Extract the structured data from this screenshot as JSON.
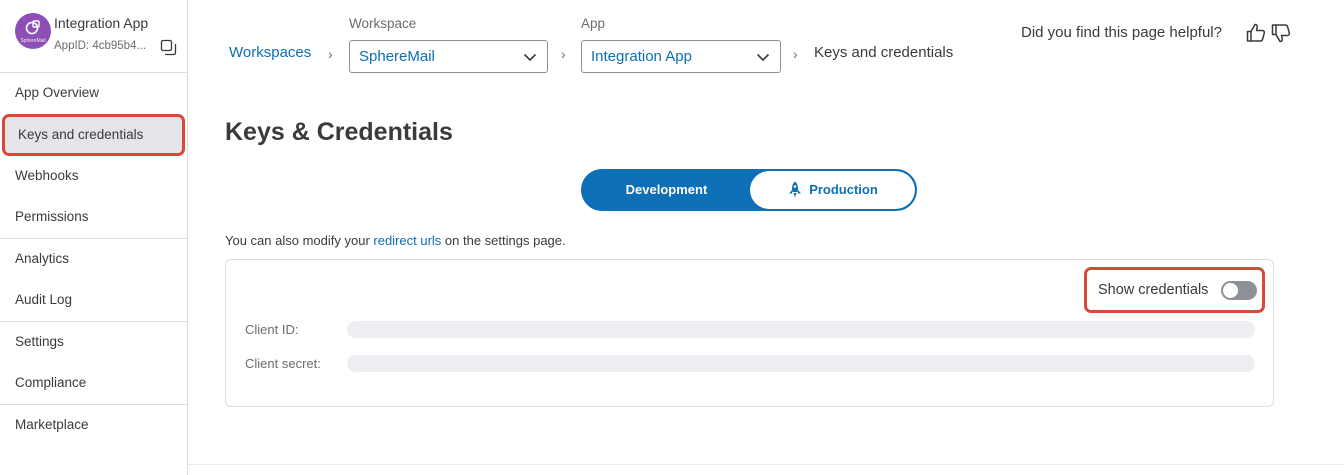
{
  "app": {
    "name": "Integration App",
    "app_id": "AppID: 4cb95b4...",
    "avatar_text": "SphereMail",
    "avatar_color": "#8d4fb5"
  },
  "sidebar": {
    "items": [
      {
        "label": "App Overview"
      },
      {
        "label": "Keys and credentials"
      },
      {
        "label": "Webhooks"
      },
      {
        "label": "Permissions"
      },
      {
        "label": "Analytics"
      },
      {
        "label": "Audit Log"
      },
      {
        "label": "Settings"
      },
      {
        "label": "Compliance"
      },
      {
        "label": "Marketplace"
      }
    ],
    "active_index": 1
  },
  "breadcrumb": {
    "root": "Workspaces",
    "workspace_label": "Workspace",
    "workspace_value": "SphereMail",
    "app_label": "App",
    "app_value": "Integration App",
    "current": "Keys and credentials"
  },
  "feedback": {
    "question": "Did you find this page helpful?"
  },
  "page": {
    "title": "Keys & Credentials"
  },
  "environment": {
    "development_label": "Development",
    "production_label": "Production",
    "selected": "Development"
  },
  "info": {
    "prefix": "You can also modify your ",
    "link": "redirect urls",
    "suffix": " on the settings page."
  },
  "credentials": {
    "show_label": "Show credentials",
    "show_enabled": false,
    "client_id_label": "Client ID:",
    "client_secret_label": "Client secret:"
  },
  "colors": {
    "accent": "#0d6fb5",
    "highlight": "#d9493a"
  }
}
